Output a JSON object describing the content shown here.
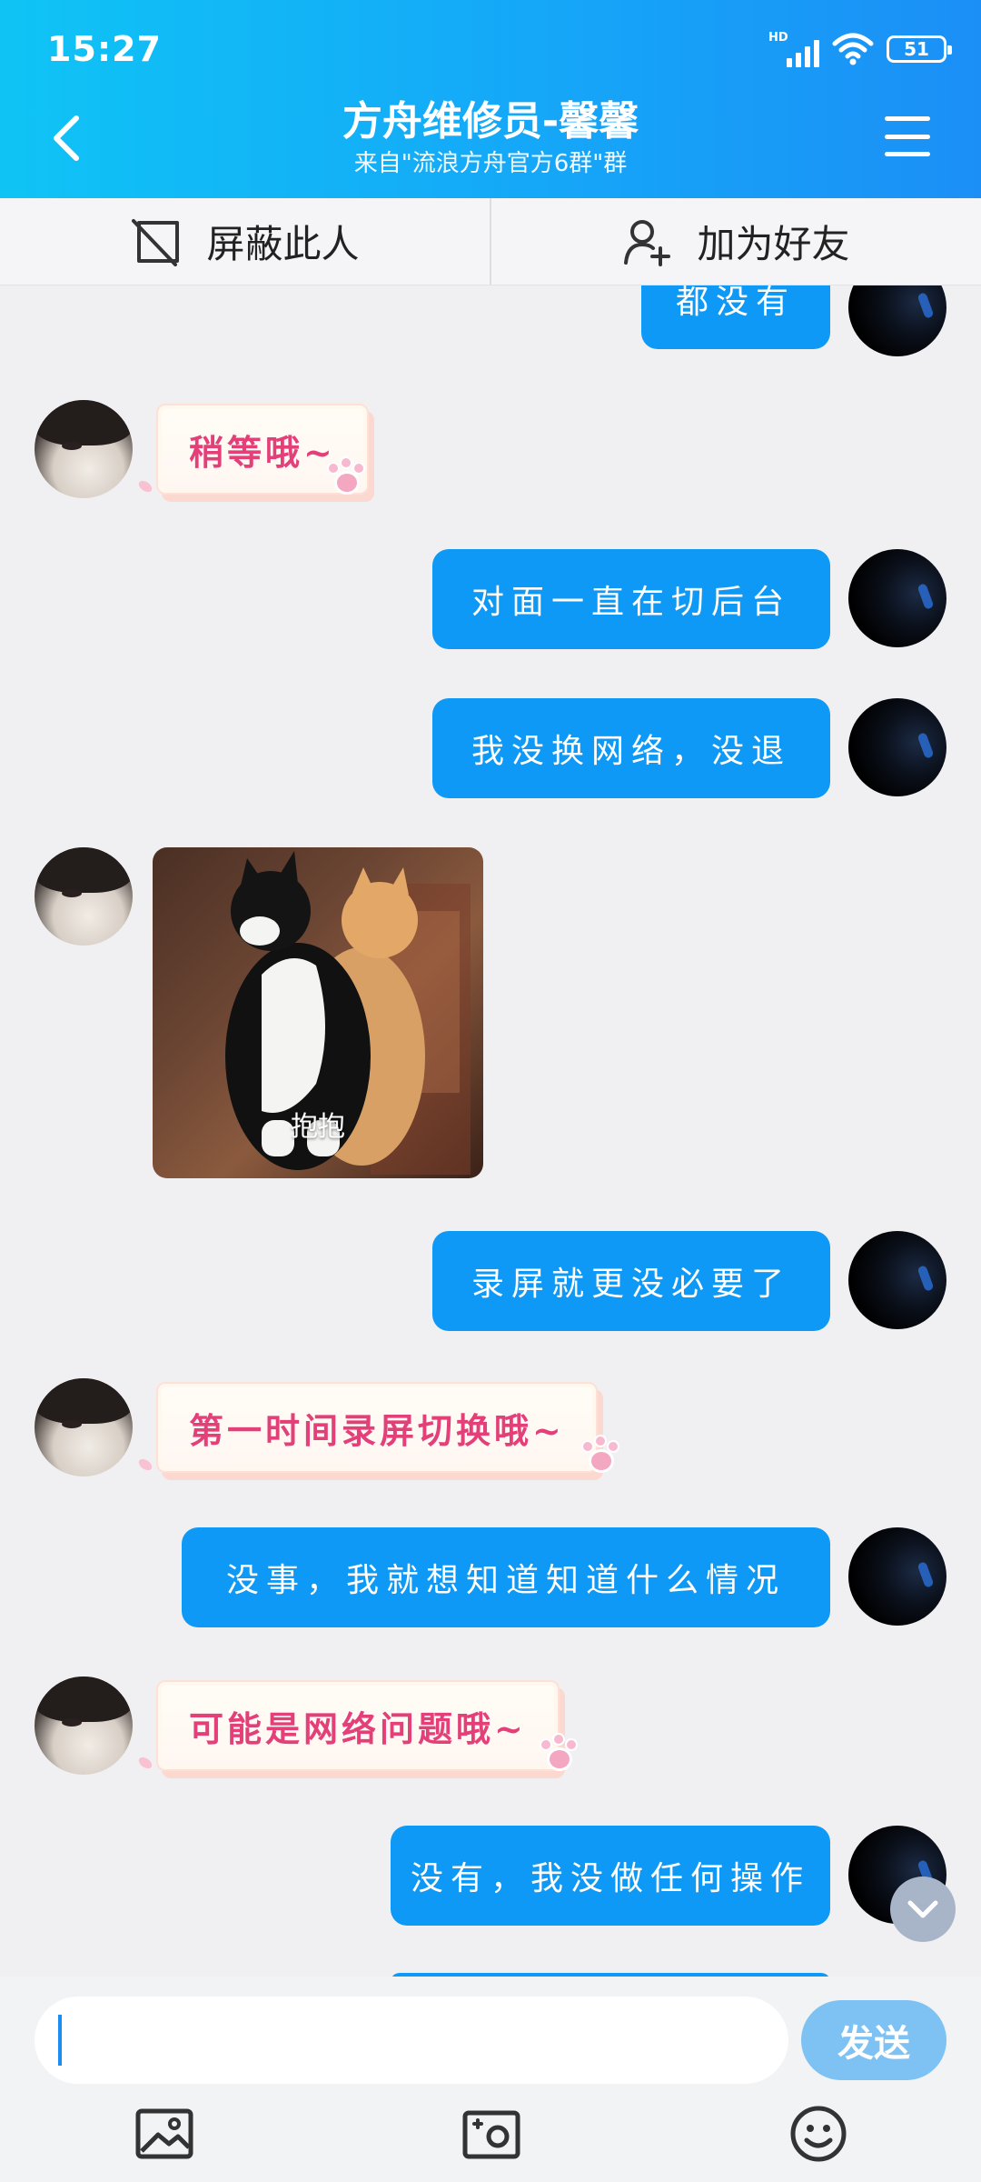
{
  "status_bar": {
    "time": "15:27",
    "network": "HD",
    "battery": "51"
  },
  "header": {
    "title": "方舟维修员-馨馨",
    "subtitle": "来自\"流浪方舟官方6群\"群"
  },
  "actions": {
    "block_label": "屏蔽此人",
    "add_friend_label": "加为好友"
  },
  "messages": [
    {
      "side": "me",
      "text": "都没有"
    },
    {
      "side": "other",
      "type": "sticker",
      "text": "稍等哦~"
    },
    {
      "side": "me",
      "text": "对面一直在切后台"
    },
    {
      "side": "me",
      "text": "我没换网络，没退"
    },
    {
      "side": "other",
      "type": "image",
      "caption": "抱抱"
    },
    {
      "side": "me",
      "text": "录屏就更没必要了"
    },
    {
      "side": "other",
      "type": "sticker",
      "text": "第一时间录屏切换哦~"
    },
    {
      "side": "me",
      "text": "没事，我就想知道知道什么情况"
    },
    {
      "side": "other",
      "type": "sticker",
      "text": "可能是网络问题哦~"
    },
    {
      "side": "me",
      "text": "没有，我没做任何操作"
    }
  ],
  "input": {
    "value": "",
    "send_label": "发送"
  },
  "toolbar": {
    "icons": [
      "image-icon",
      "camera-icon",
      "emoji-icon"
    ]
  },
  "colors": {
    "header_gradient_start": "#0fc4f5",
    "header_gradient_end": "#1b8ff6",
    "my_bubble": "#0d99f5",
    "sticker_text": "#e3407a",
    "send_button": "#7ec1f3"
  }
}
